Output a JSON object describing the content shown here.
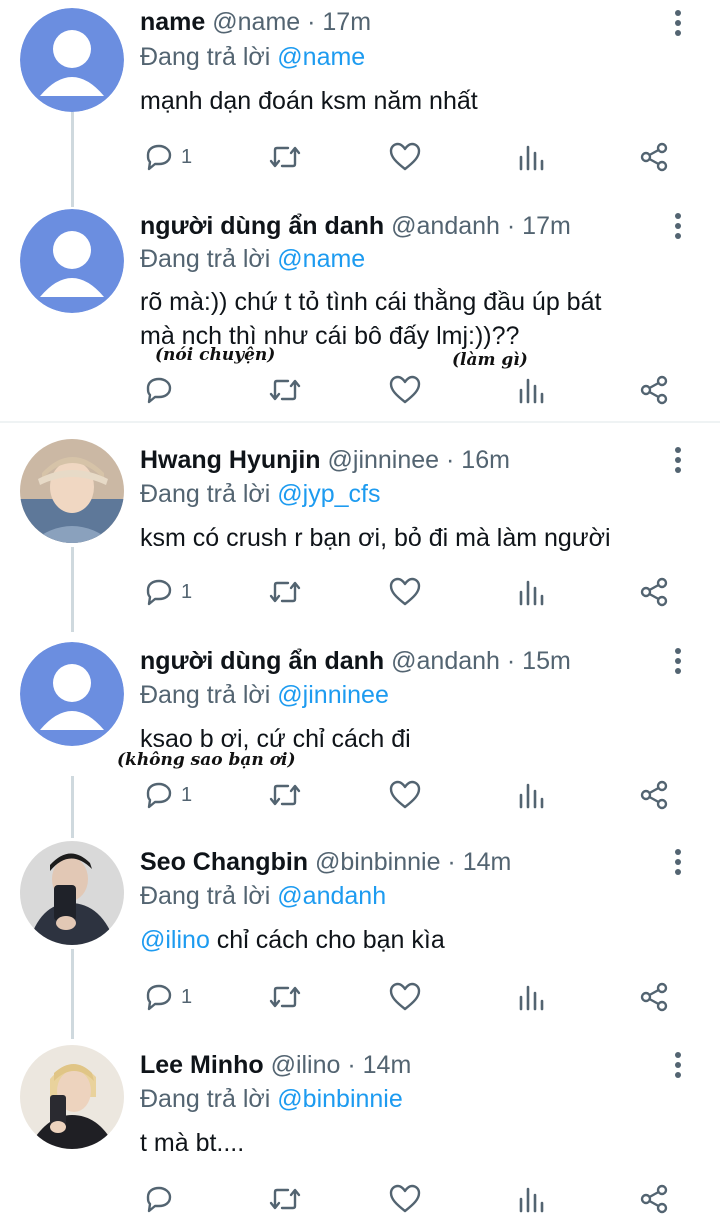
{
  "reply_prefix": "Đang trả lời",
  "tweets": [
    {
      "name": "name",
      "handle": "@name",
      "time": "17m",
      "reply_to": "@name",
      "text": "mạnh dạn đoán ksm năm nhất",
      "reply_count": "1",
      "avatar": "default-avatar"
    },
    {
      "name": "người dùng ẩn danh",
      "handle": "@andanh",
      "time": "17m",
      "reply_to": "@name",
      "text_line1": "rõ mà:)) chứ t tỏ tình cái thằng đầu úp bát",
      "text_line2": "mà nch thì như cái bô đấy lmj:))??",
      "note1": "(nói chuyện)",
      "note2": "(làm gì)",
      "reply_count": "",
      "avatar": "default-avatar"
    },
    {
      "name": "Hwang Hyunjin",
      "handle": "@jinninee",
      "time": "16m",
      "reply_to": "@jyp_cfs",
      "text": "ksm có crush r bạn ơi, bỏ đi mà làm người",
      "reply_count": "1",
      "avatar": "photo-avatar"
    },
    {
      "name": "người dùng ẩn danh",
      "handle": "@andanh",
      "time": "15m",
      "reply_to": "@jinninee",
      "text": "ksao b ơi, cứ chỉ cách đi",
      "note1": "(không sao bạn ơi)",
      "reply_count": "1",
      "avatar": "default-avatar"
    },
    {
      "name": "Seo Changbin",
      "handle": "@binbinnie",
      "time": "14m",
      "reply_to": "@andanh",
      "text_mention": "@ilino",
      "text": " chỉ cách cho bạn kìa",
      "reply_count": "1",
      "avatar": "photo-avatar"
    },
    {
      "name": "Lee Minho",
      "handle": "@ilino",
      "time": "14m",
      "reply_to": "@binbinnie",
      "text": "t mà bt....",
      "reply_count": "",
      "avatar": "photo-avatar"
    }
  ],
  "colors": {
    "link": "#1d9bf0",
    "secondary": "#536471",
    "avatar_default": "#6b8ee0"
  },
  "icons": [
    "reply-icon",
    "retweet-icon",
    "like-icon",
    "analytics-icon",
    "share-icon",
    "more-icon",
    "default-avatar-icon"
  ]
}
